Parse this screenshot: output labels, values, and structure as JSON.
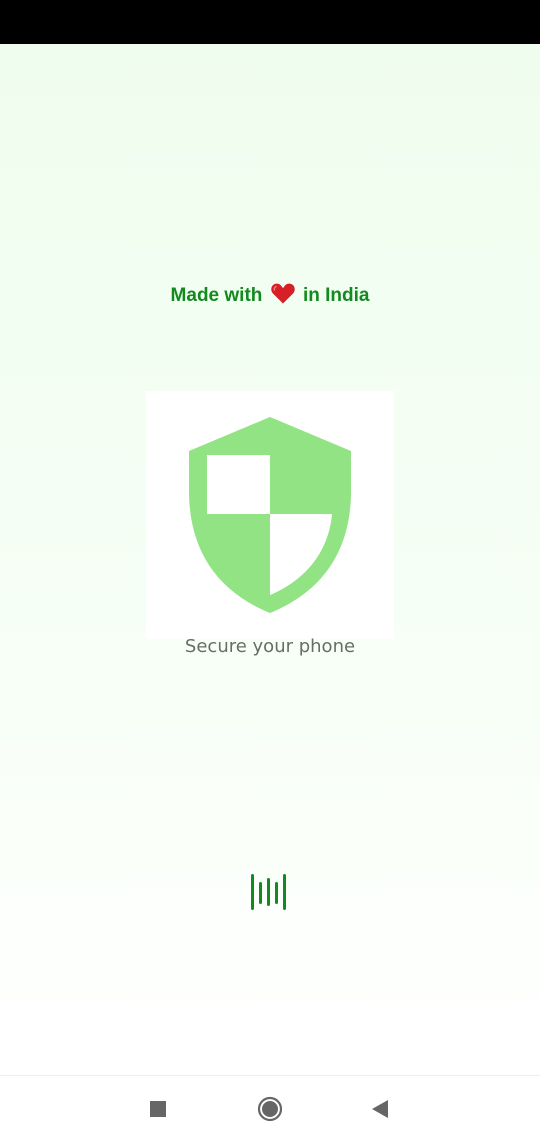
{
  "colors": {
    "brand_green": "#138a1f",
    "shield_green": "#92e384",
    "heart_red": "#d61f26",
    "subtitle_gray": "#6b6b6b",
    "nav_icon_gray": "#666666"
  },
  "splash": {
    "tagline_prefix": "Made with",
    "tagline_suffix": "in India",
    "heart_icon": "heart-icon",
    "logo_icon": "shield-icon",
    "subtitle": "Secure your phone",
    "loader_icon": "loading-bars-icon"
  },
  "nav_bar": {
    "recents_icon": "square-icon",
    "home_icon": "circle-icon",
    "back_icon": "triangle-back-icon"
  }
}
